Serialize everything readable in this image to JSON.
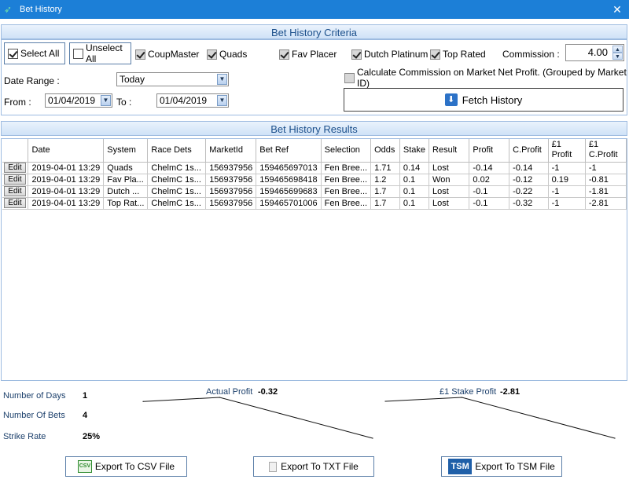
{
  "window": {
    "title": "Bet History",
    "close_glyph": "✕",
    "app_icon": "app-logo-icon"
  },
  "criteria": {
    "header": "Bet History Criteria",
    "select_all": {
      "label": "Select All",
      "checked": true
    },
    "unselect_all": {
      "label": "Unselect All",
      "checked": false
    },
    "systems": [
      {
        "label": "CoupMaster",
        "checked": true
      },
      {
        "label": "Quads",
        "checked": true
      },
      {
        "label": "Fav Placer",
        "checked": true
      },
      {
        "label": "Dutch Platinum",
        "checked": true
      },
      {
        "label": "Top Rated",
        "checked": true
      }
    ],
    "commission_label": "Commission :",
    "commission_value": "4.00",
    "date_range_label": "Date Range :",
    "date_range_value": "Today",
    "from_label": "From :",
    "from_value": "01/04/2019",
    "to_label": "To :",
    "to_value": "01/04/2019",
    "calc_commission_label": "Calculate Commission on Market Net Profit. (Grouped by Market ID)",
    "calc_commission_checked": false,
    "fetch_label": "Fetch History"
  },
  "results": {
    "header": "Bet History Results",
    "columns": [
      "",
      "Date",
      "System",
      "Race Dets",
      "MarketId",
      "Bet Ref",
      "Selection",
      "Odds",
      "Stake",
      "Result",
      "Profit",
      "C.Profit",
      "£1 Profit",
      "£1 C.Profit"
    ],
    "edit_label": "Edit",
    "rows": [
      [
        "2019-04-01 13:29",
        "Quads",
        "ChelmC  1s...",
        "156937956",
        "159465697013",
        "Fen Bree...",
        "1.71",
        "0.14",
        "Lost",
        "-0.14",
        "-0.14",
        "-1",
        "-1"
      ],
      [
        "2019-04-01 13:29",
        "Fav Pla...",
        "ChelmC  1s...",
        "156937956",
        "159465698418",
        "Fen Bree...",
        "1.2",
        "0.1",
        "Won",
        "0.02",
        "-0.12",
        "0.19",
        "-0.81"
      ],
      [
        "2019-04-01 13:29",
        "Dutch ...",
        "ChelmC  1s...",
        "156937956",
        "159465699683",
        "Fen Bree...",
        "1.7",
        "0.1",
        "Lost",
        "-0.1",
        "-0.22",
        "-1",
        "-1.81"
      ],
      [
        "2019-04-01 13:29",
        "Top Rat...",
        "ChelmC  1s...",
        "156937956",
        "159465701006",
        "Fen Bree...",
        "1.7",
        "0.1",
        "Lost",
        "-0.1",
        "-0.32",
        "-1",
        "-2.81"
      ]
    ]
  },
  "summary": {
    "days_label": "Number of Days",
    "days_value": "1",
    "bets_label": "Number Of Bets",
    "bets_value": "4",
    "strike_label": "Strike Rate",
    "strike_value": "25%",
    "actual_profit_label": "Actual Profit",
    "actual_profit_value": "-0.32",
    "stake_profit_label": "£1 Stake Profit",
    "stake_profit_value": "-2.81"
  },
  "chart_data": [
    {
      "type": "line",
      "title": "Actual Profit",
      "x": [
        1,
        2,
        3,
        4
      ],
      "values": [
        -0.14,
        -0.12,
        -0.22,
        -0.32
      ]
    },
    {
      "type": "line",
      "title": "£1 Stake Profit",
      "x": [
        1,
        2,
        3,
        4
      ],
      "values": [
        -1,
        -0.81,
        -1.81,
        -2.81
      ]
    }
  ],
  "exports": {
    "csv_label": "Export To CSV File",
    "csv_icon_text": "CSV",
    "txt_label": "Export To TXT File",
    "tsm_label": "Export To TSM File",
    "tsm_icon_text": "TSM"
  },
  "colors": {
    "titlebar": "#1c7fd7",
    "header_text": "#1b4f8b",
    "accent": "#2c72c7"
  }
}
